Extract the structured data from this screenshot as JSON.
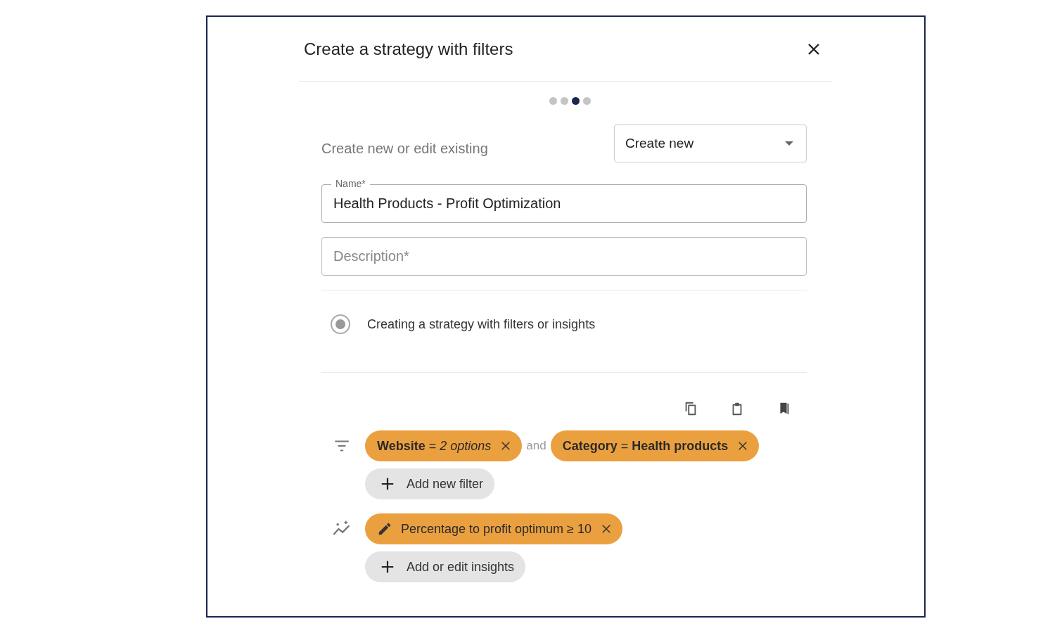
{
  "dialog": {
    "title": "Create a strategy with filters"
  },
  "steps": [
    {
      "selected": false
    },
    {
      "selected": false
    },
    {
      "selected": true
    },
    {
      "selected": false
    }
  ],
  "mode": {
    "label": "Create new or edit existing",
    "value": "Create new"
  },
  "name_field": {
    "label": "Name*",
    "value": "Health Products - Profit Optimization"
  },
  "description_field": {
    "placeholder": "Description*"
  },
  "option": {
    "label": "Creating a strategy with filters or insights",
    "selected": true
  },
  "filters": [
    {
      "text": "**Website** = *2 options*"
    },
    {
      "text": "**Category** = **Health products**"
    }
  ],
  "filter_joiner": "and",
  "add_filter": "Add new filter",
  "insights": [
    {
      "text": "Percentage to profit optimum ≥ 10"
    }
  ],
  "add_insight": "Add or edit insights"
}
